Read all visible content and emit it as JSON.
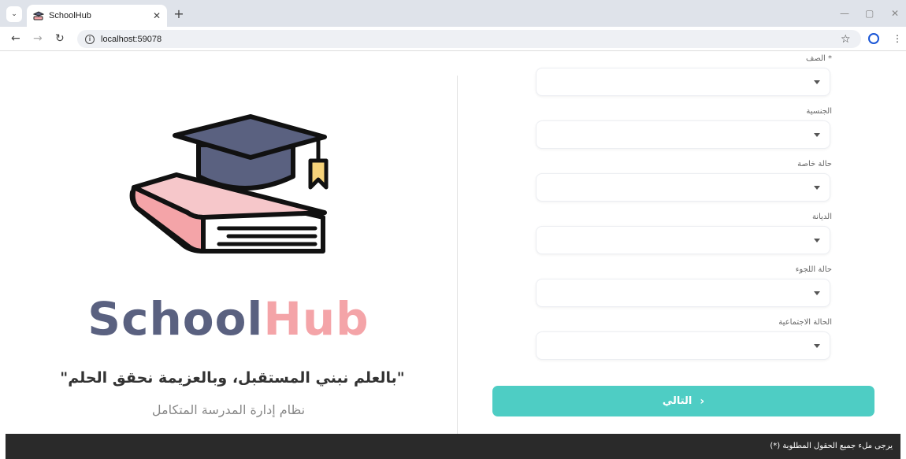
{
  "browser": {
    "tab_title": "SchoolHub",
    "url": "localhost:59078"
  },
  "hero": {
    "brand_part1": "School",
    "brand_part2": "Hub",
    "slogan": "\"بالعلم نبني المستقبل، وبالعزيمة نحقق الحلم\"",
    "subtitle": "نظام إدارة المدرسة المتكامل",
    "colors": {
      "brand_dark": "#5a6180",
      "brand_pink": "#f4a4a8"
    }
  },
  "form": {
    "fields": [
      {
        "label": "* الصف",
        "value": ""
      },
      {
        "label": "الجنسية",
        "value": ""
      },
      {
        "label": "حالة خاصة",
        "value": ""
      },
      {
        "label": "الديانة",
        "value": ""
      },
      {
        "label": "حالة اللجوء",
        "value": ""
      },
      {
        "label": "الحالة الاجتماعية",
        "value": ""
      }
    ],
    "next_label": "التالي",
    "accent": "#4ecdc4"
  },
  "footer": {
    "text": "يرجى ملء جميع الحقول المطلوبة (*)"
  }
}
